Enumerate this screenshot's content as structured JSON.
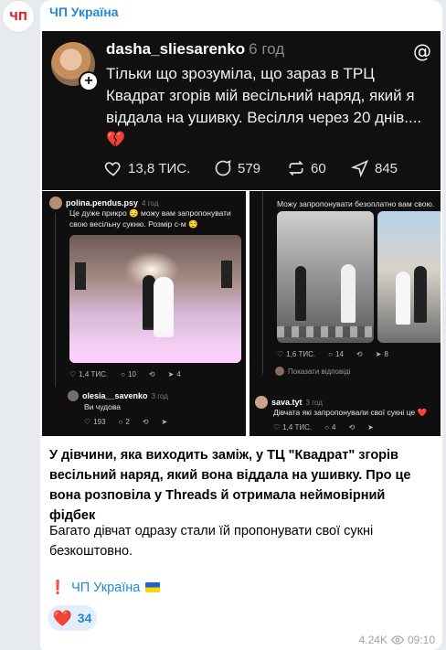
{
  "channel": {
    "avatar_text": "ЧП",
    "name": "ЧП Україна"
  },
  "threads_post": {
    "username": "dasha_sliesarenko",
    "time": "6 год",
    "text": "Тільки що зрозуміла, що зараз в ТРЦ Квадрат згорів мій весільний наряд, який я віддала на ушивку. Весілля через 20 днів....💔",
    "stats": {
      "likes": "13,8 ТИС.",
      "comments": "579",
      "reposts": "60",
      "shares": "845"
    }
  },
  "screenshot_left": {
    "user": "polina.pendus.psy",
    "time": "4 год",
    "text": "Це дуже прикро 😔 можу вам запропонувати свою весільну сукню. Розмір с-м 😌",
    "stats": {
      "likes": "1,4 ТИС.",
      "comments": "10",
      "shares": "4"
    },
    "reply_user": "olesia__savenko",
    "reply_time": "3 год",
    "reply_text": "Ви чудова",
    "reply_stats": {
      "likes": "193",
      "comments": "2"
    }
  },
  "screenshot_right": {
    "top_text": "Можу запропонувати безоплатно вам свою.",
    "stats": {
      "likes": "1,6 ТИС.",
      "comments": "14",
      "shares": "8"
    },
    "show_replies": "Показати відповіді",
    "reply_user": "sava.tyt",
    "reply_time": "3 год",
    "reply_text": "Дівчата які запропонували свої сукні це ❤️",
    "reply_stats": {
      "likes": "1,4 ТИС.",
      "comments": "4"
    }
  },
  "caption": {
    "bold": "У дівчини, яка виходить заміж, у ТЦ \"Квадрат\" згорів весільний наряд, який вона віддала на ушивку. Про це вона розповіла у Threads й отримала неймовірний фідбек",
    "p2": "Багато дівчат одразу стали їй пропонувати свої сукні безкоштовно.",
    "signature": "ЧП Україна"
  },
  "reaction": {
    "emoji": "❤️",
    "count": "34"
  },
  "meta": {
    "views": "4.24K",
    "time": "09:10"
  }
}
